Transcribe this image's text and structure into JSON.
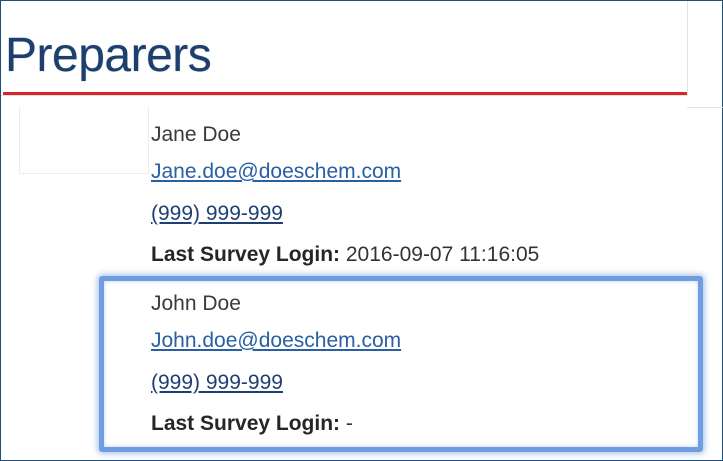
{
  "page": {
    "title": "Preparers"
  },
  "preparers": [
    {
      "name": "Jane Doe",
      "email": "Jane.doe@doeschem.com",
      "phone": "(999) 999-999",
      "last_login_label": "Last Survey Login:",
      "last_login_value": "2016-09-07 11:16:05"
    },
    {
      "name": "John Doe",
      "email": "John.doe@doeschem.com",
      "phone": "(999) 999-999",
      "last_login_label": "Last Survey Login:",
      "last_login_value": "-"
    }
  ],
  "colors": {
    "title": "#1c3f6e",
    "underline": "#d9262b",
    "link": "#2a5fa3",
    "highlight": "#6f9de0"
  }
}
